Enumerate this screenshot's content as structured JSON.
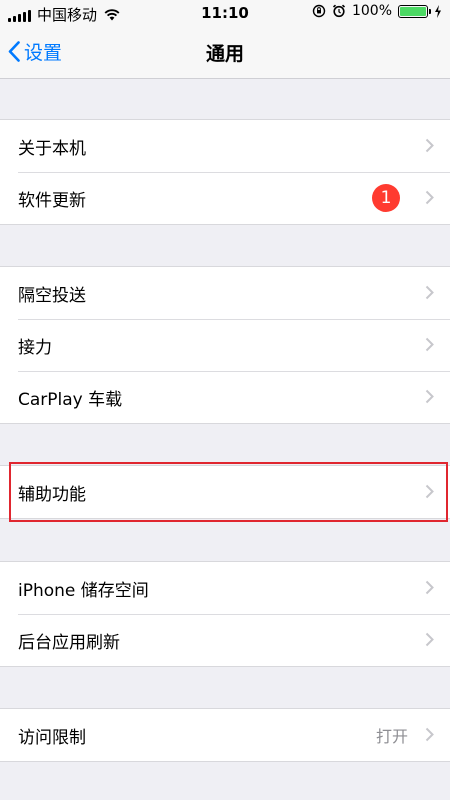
{
  "status_bar": {
    "carrier": "中国移动",
    "time": "11:10",
    "battery_percent": "100%",
    "battery_level": 1.0,
    "battery_color": "#4cd964"
  },
  "nav": {
    "back_label": "设置",
    "title": "通用",
    "accent": "#007aff"
  },
  "groups": [
    {
      "items": [
        {
          "label": "关于本机"
        },
        {
          "label": "软件更新",
          "badge": "1"
        }
      ]
    },
    {
      "items": [
        {
          "label": "隔空投送"
        },
        {
          "label": "接力"
        },
        {
          "label": "CarPlay 车载"
        }
      ]
    },
    {
      "items": [
        {
          "label": "辅助功能",
          "highlighted": true
        }
      ]
    },
    {
      "items": [
        {
          "label": "iPhone 储存空间"
        },
        {
          "label": "后台应用刷新"
        }
      ]
    },
    {
      "items": [
        {
          "label": "访问限制",
          "value": "打开"
        }
      ]
    }
  ]
}
